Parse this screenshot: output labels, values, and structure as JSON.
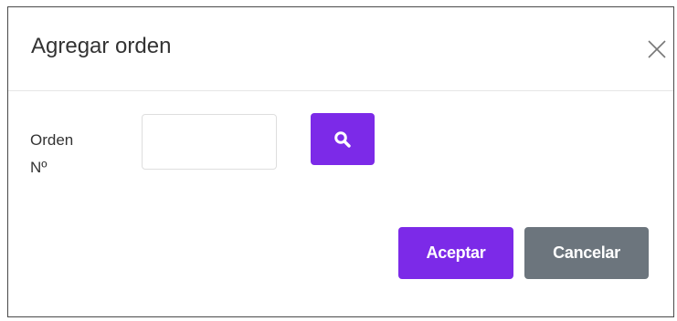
{
  "dialog": {
    "title": "Agregar orden",
    "close_icon": "close-icon"
  },
  "form": {
    "order_label_line1": "Orden",
    "order_label_line2": "Nº",
    "order_value": "",
    "search_icon": "search-icon"
  },
  "footer": {
    "accept_label": "Aceptar",
    "cancel_label": "Cancelar"
  },
  "colors": {
    "primary": "#7c2ae8",
    "secondary": "#6c757d",
    "text": "#333333"
  }
}
